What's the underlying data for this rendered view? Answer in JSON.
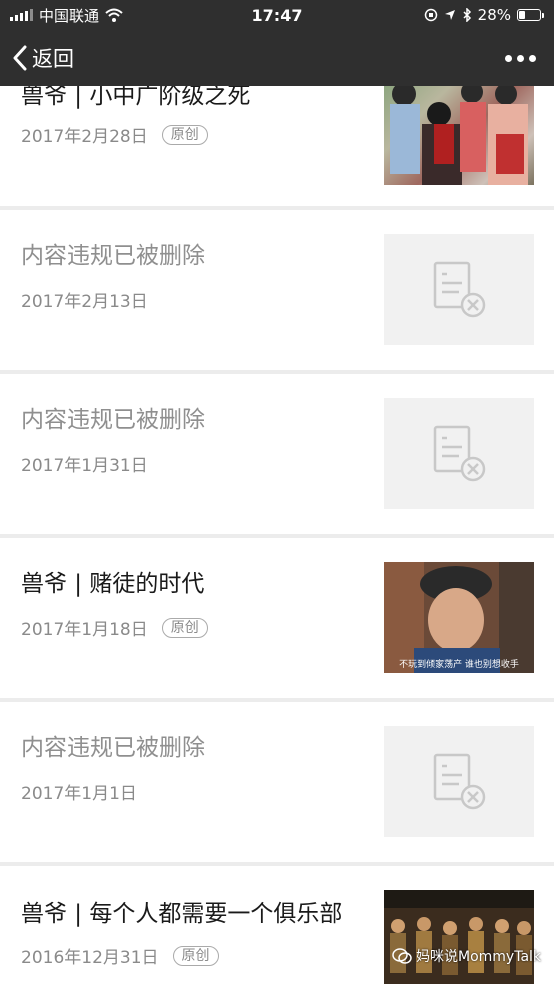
{
  "status_bar": {
    "carrier": "中国联通",
    "time": "17:47",
    "battery": "28%",
    "battery_level": 0.28
  },
  "nav": {
    "back_label": "返回",
    "icons": [
      "chevron-left-icon",
      "more-dots-icon"
    ]
  },
  "articles": [
    {
      "title": "兽爷 | 小中广阶级之死",
      "date": "2017年2月28日",
      "badge": "原创",
      "deleted": false,
      "thumb": "photo-costume-drama"
    },
    {
      "title": "内容违规已被删除",
      "date": "2017年2月13日",
      "badge": "",
      "deleted": true,
      "thumb": "deleted-document-icon"
    },
    {
      "title": "内容违规已被删除",
      "date": "2017年1月31日",
      "badge": "",
      "deleted": true,
      "thumb": "deleted-document-icon"
    },
    {
      "title": "兽爷 | 赌徒的时代",
      "date": "2017年1月18日",
      "badge": "原创",
      "deleted": false,
      "thumb": "photo-man-with-hat",
      "thumb_caption": "不玩到倾家荡产 谁也别想收手"
    },
    {
      "title": "内容违规已被删除",
      "date": "2017年1月1日",
      "badge": "",
      "deleted": true,
      "thumb": "deleted-document-icon"
    },
    {
      "title": "兽爷 | 每个人都需要一个俱乐部",
      "date": "2016年12月31日",
      "badge": "原创",
      "deleted": false,
      "thumb": "photo-crowd"
    }
  ],
  "watermark": "妈咪说MommyTalk",
  "colors": {
    "bar": "#2f2f2f",
    "card": "#ffffff",
    "separator": "#ececec"
  }
}
